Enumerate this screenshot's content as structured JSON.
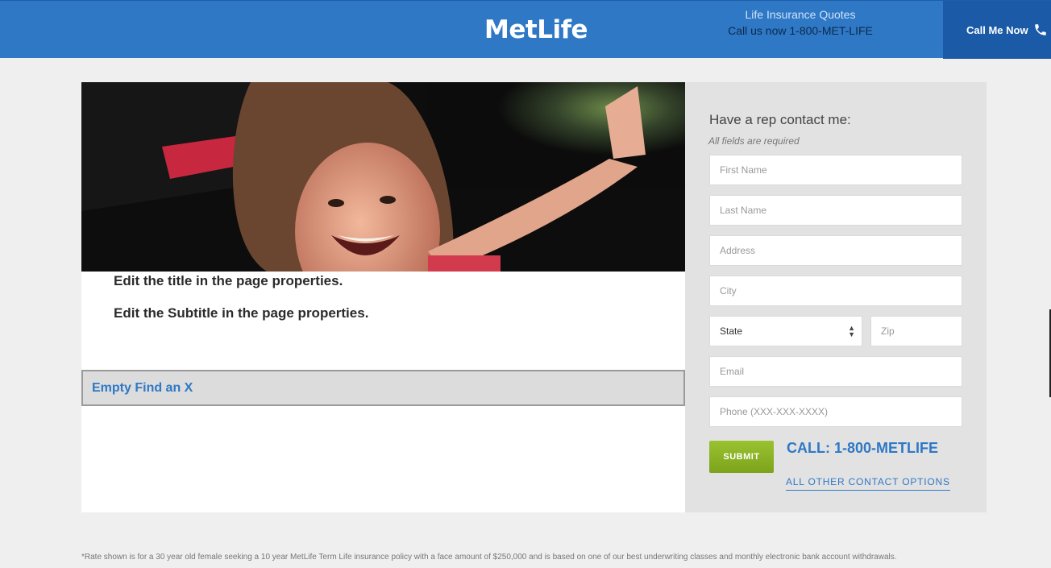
{
  "header": {
    "logo": "MetLife",
    "quote_title": "Life Insurance Quotes",
    "quote_phone": "Call us now 1-800-MET-LIFE",
    "call_button": "Call Me Now",
    "call_icon": "phone-icon",
    "brand_color": "#2e78c6"
  },
  "main": {
    "title": "Edit the title in the page properties.",
    "subtitle": "Edit the Subtitle in the page properties.",
    "find_label": "Empty Find an X"
  },
  "form": {
    "heading": "Have a rep contact me:",
    "note": "All fields are required",
    "first_name_placeholder": "First Name",
    "last_name_placeholder": "Last Name",
    "address_placeholder": "Address",
    "city_placeholder": "City",
    "state_value": "State",
    "zip_placeholder": "Zip",
    "email_placeholder": "Email",
    "phone_placeholder": "Phone (XXX-XXX-XXXX)",
    "submit_label": "SUBMIT",
    "call_text": "CALL: 1-800-METLIFE",
    "other_options": "ALL OTHER CONTACT OPTIONS",
    "submit_color": "#8cb528"
  },
  "footer": {
    "disclaimer": "*Rate shown is for a 30 year old female seeking a 10 year MetLife Term Life insurance policy with a face amount of $250,000 and is based on one of our best underwriting classes and monthly electronic bank account withdrawals."
  }
}
